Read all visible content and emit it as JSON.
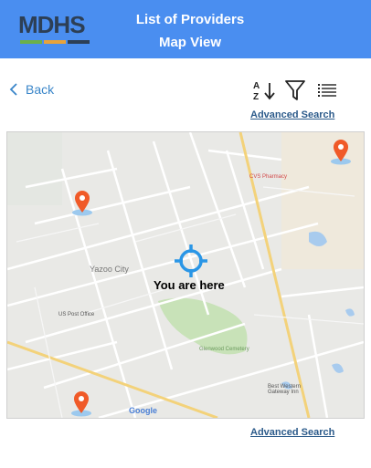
{
  "header": {
    "logo_text": "MDHS",
    "title_line1": "List of Providers",
    "title_line2": "Map View",
    "background": "#4a8ef0"
  },
  "nav": {
    "back_label": "Back"
  },
  "toolbar": {
    "sort_icon": "sort-az-icon",
    "filter_icon": "filter-icon",
    "list_icon": "list-view-icon"
  },
  "links": {
    "advanced_search_top": "Advanced Search",
    "advanced_search_bottom": "Advanced Search"
  },
  "map": {
    "you_are_here": "You are here",
    "labels": {
      "city": "Yazoo City",
      "pharmacy": "CVS Pharmacy",
      "post_office": "US Post Office",
      "cemetery": "Glenwood Cemetery",
      "healthcare": "Best Western Gateway Inn",
      "google": "Google"
    },
    "pin_color": "#f05a28",
    "locator_color": "#2a96e6"
  }
}
